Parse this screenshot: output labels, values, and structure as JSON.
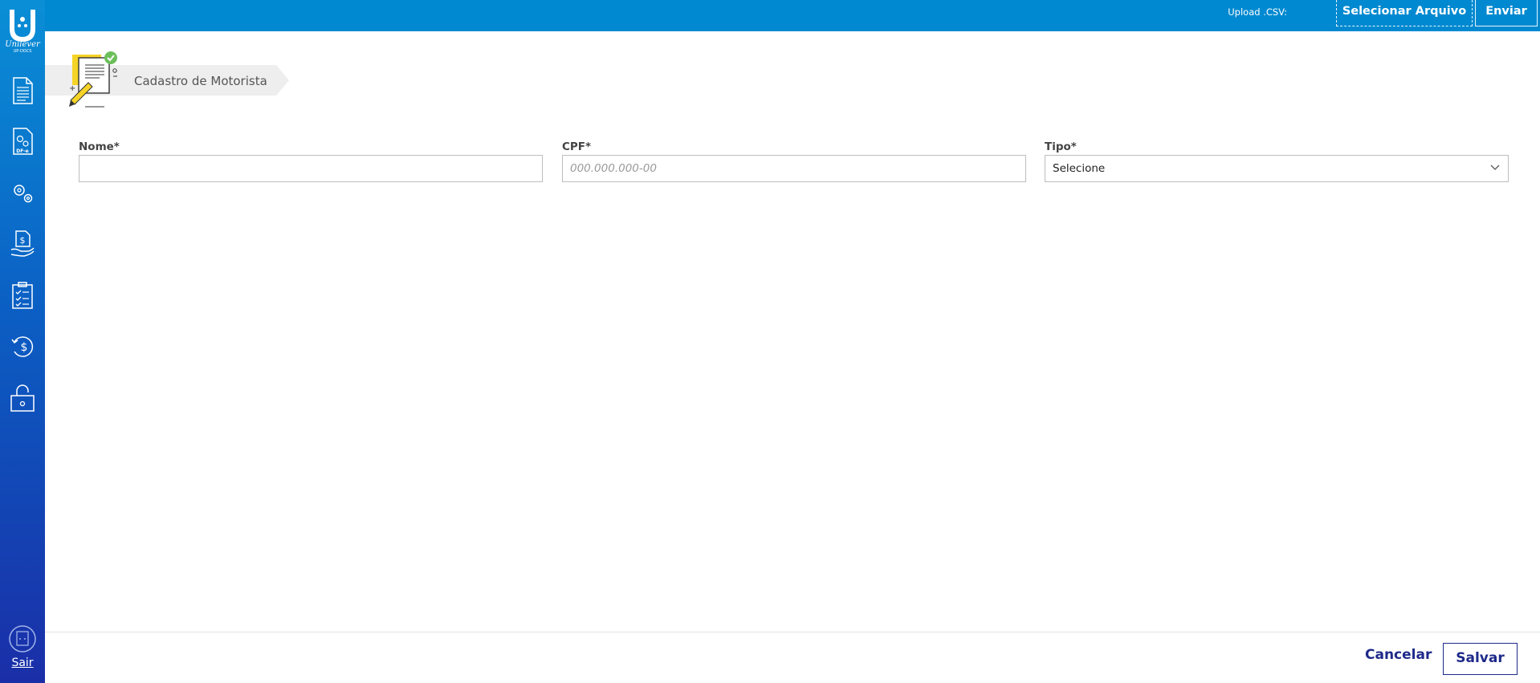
{
  "brand": {
    "name": "Unilever",
    "sub": "UP-DOCS",
    "icon": "unilever-u-logo"
  },
  "sidebar": {
    "items": [
      {
        "name": "document",
        "icon": "document-icon"
      },
      {
        "name": "dfe",
        "icon": "dfe-gears-document-icon",
        "badge": "DF-e"
      },
      {
        "name": "settings",
        "icon": "gears-icon"
      },
      {
        "name": "payment",
        "icon": "money-hand-icon"
      },
      {
        "name": "checklist",
        "icon": "clipboard-checklist-icon"
      },
      {
        "name": "refund",
        "icon": "money-history-icon"
      },
      {
        "name": "lock",
        "icon": "unlock-icon"
      }
    ],
    "logout_label": "Sair",
    "logout_icon": "exit-door-icon"
  },
  "topbar": {
    "upload_label": "Upload .CSV:",
    "select_file_label": "Selecionar Arquivo",
    "send_label": "Enviar",
    "download_icon": "download-icon"
  },
  "breadcrumb": {
    "title": "Cadastro de Motorista",
    "icon": "document-sign-illustration"
  },
  "form": {
    "nome": {
      "label": "Nome*",
      "value": ""
    },
    "cpf": {
      "label": "CPF*",
      "placeholder": "000.000.000-00"
    },
    "tipo": {
      "label": "Tipo*",
      "value": "Selecione"
    }
  },
  "footer": {
    "cancel_label": "Cancelar",
    "save_label": "Salvar"
  },
  "colors": {
    "primary": "#0089d0",
    "accent": "#1e2a8a",
    "sidebar_bottom": "#1a2ea8"
  }
}
